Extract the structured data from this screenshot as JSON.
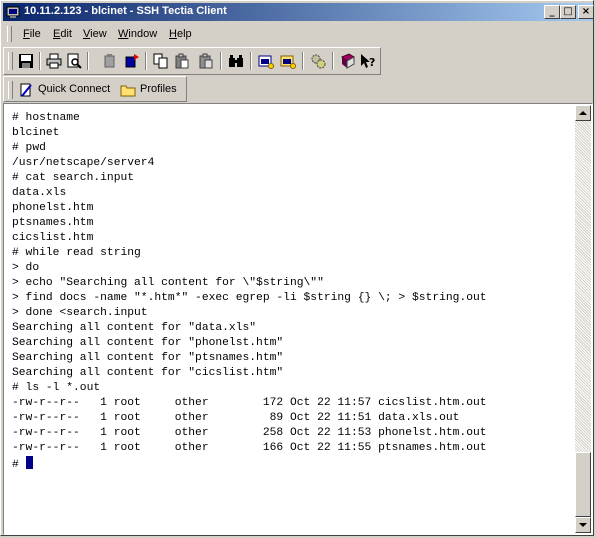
{
  "window": {
    "title": "10.11.2.123 - blcinet - SSH Tectia Client",
    "controls": {
      "minimize": "_",
      "maximize": "□",
      "close": "×"
    }
  },
  "menu": [
    {
      "pre": "",
      "u": "F",
      "post": "ile"
    },
    {
      "pre": "",
      "u": "E",
      "post": "dit"
    },
    {
      "pre": "",
      "u": "V",
      "post": "iew"
    },
    {
      "pre": "",
      "u": "W",
      "post": "indow"
    },
    {
      "pre": "",
      "u": "H",
      "post": "elp"
    }
  ],
  "toolbar": {
    "icons": [
      "save-icon",
      "print-icon",
      "print-preview-icon",
      "disconnect-icon",
      "new-connection-icon",
      "copy-icon",
      "paste-icon",
      "paste-special-icon",
      "find-icon",
      "file-transfer-icon",
      "new-file-transfer-icon",
      "settings-icon",
      "help-book-icon",
      "context-help-icon"
    ]
  },
  "quick": {
    "quick_connect": "Quick Connect",
    "profiles": "Profiles"
  },
  "terminal": {
    "lines": [
      "# hostname",
      "blcinet",
      "# pwd",
      "/usr/netscape/server4",
      "# cat search.input",
      "data.xls",
      "phonelst.htm",
      "ptsnames.htm",
      "cicslist.htm",
      "# while read string",
      "> do",
      "> echo \"Searching all content for \\\"$string\\\"\"",
      "> find docs -name \"*.htm*\" -exec egrep -li $string {} \\; > $string.out",
      "> done <search.input",
      "Searching all content for \"data.xls\"",
      "Searching all content for \"phonelst.htm\"",
      "Searching all content for \"ptsnames.htm\"",
      "Searching all content for \"cicslist.htm\"",
      "# ls -l *.out",
      "-rw-r--r--   1 root     other        172 Oct 22 11:57 cicslist.htm.out",
      "-rw-r--r--   1 root     other         89 Oct 22 11:51 data.xls.out",
      "-rw-r--r--   1 root     other        258 Oct 22 11:53 phonelst.htm.out",
      "-rw-r--r--   1 root     other        166 Oct 22 11:55 ptsnames.htm.out"
    ],
    "prompt": "# "
  }
}
